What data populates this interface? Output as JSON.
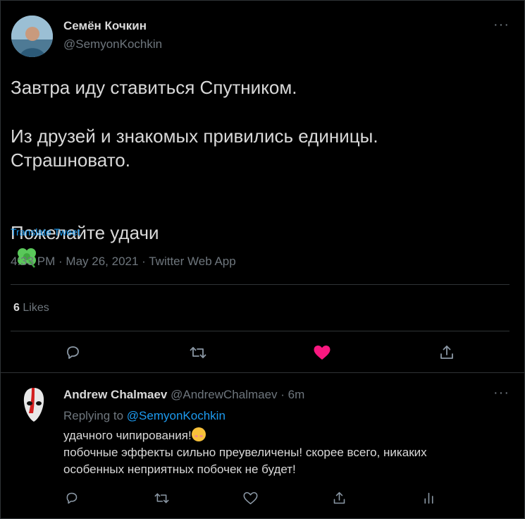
{
  "tweet": {
    "author_name": "Семён Кочкин",
    "author_handle": "@SemyonKochkin",
    "text_line1": "Завтра иду ставиться Спутником.",
    "text_line2": "Из друзей и знакомых привились единицы.",
    "text_line3": "Страшновато.",
    "text_line4": "Пожелайте удачи",
    "emoji": "shamrock-emoji",
    "translate_label": "Translate Tweet",
    "timestamp": "4:33 PM · May 26, 2021 · Twitter Web App",
    "likes_count": "6",
    "likes_label": "Likes",
    "liked": true,
    "like_color": "#f91880"
  },
  "reply": {
    "author_name": "Andrew Chalmaev",
    "author_handle": "@AndrewChalmaev",
    "time": "· 6m",
    "replying_label": "Replying to",
    "replying_to": "@SemyonKochkin",
    "line1": "удачного чипирования!",
    "line2": "побочные эффекты сильно преувеличены! скорее всего, никаких",
    "line3": "особенных неприятных побочек не будет!"
  },
  "colors": {
    "accent": "#1d9bf0",
    "muted": "#6e767d",
    "background": "#000000"
  }
}
